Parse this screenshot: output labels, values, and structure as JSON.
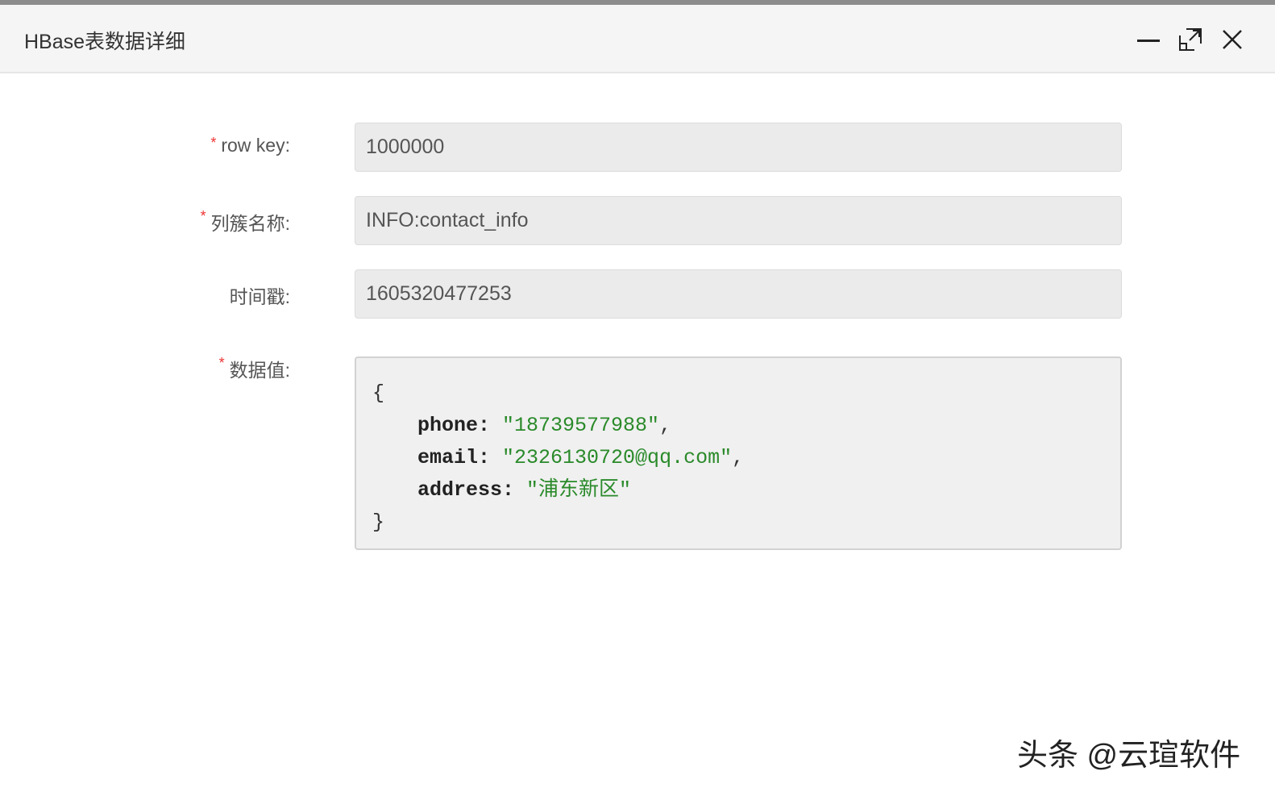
{
  "dialog": {
    "title": "HBase表数据详细"
  },
  "form": {
    "row_key": {
      "label": "row key:",
      "value": "1000000",
      "required": true
    },
    "column_family": {
      "label": "列簇名称:",
      "value": "INFO:contact_info",
      "required": true
    },
    "timestamp": {
      "label": "时间戳:",
      "value": "1605320477253",
      "required": false
    },
    "data_value": {
      "label": "数据值:",
      "required": true,
      "open": "{",
      "close": "}",
      "fields": [
        {
          "key": "phone:",
          "value": "\"18739577988\"",
          "sep": ","
        },
        {
          "key": "email:",
          "value": "\"2326130720@qq.com\"",
          "sep": ","
        },
        {
          "key": "address:",
          "value": "\"浦东新区\"",
          "sep": ""
        }
      ]
    }
  },
  "required_mark": "*",
  "watermark": "头条 @云瑄软件"
}
